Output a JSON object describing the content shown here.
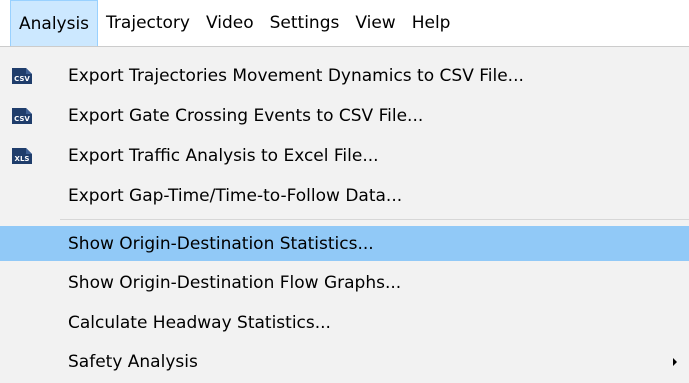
{
  "menubar": {
    "items": [
      {
        "label": "Analysis",
        "active": true
      },
      {
        "label": "Trajectory"
      },
      {
        "label": "Video"
      },
      {
        "label": "Settings"
      },
      {
        "label": "View"
      },
      {
        "label": "Help"
      }
    ]
  },
  "dropdown": {
    "items": [
      {
        "label": "Export Trajectories Movement Dynamics to CSV File...",
        "icon": "csv-file-icon",
        "icon_text": "CSV"
      },
      {
        "label": "Export Gate Crossing Events to CSV File...",
        "icon": "csv-file-icon",
        "icon_text": "CSV"
      },
      {
        "label": "Export Traffic Analysis to Excel File...",
        "icon": "xls-file-icon",
        "icon_text": "XLS"
      },
      {
        "label": "Export Gap-Time/Time-to-Follow Data..."
      },
      {
        "label": "Show Origin-Destination Statistics...",
        "highlighted": true
      },
      {
        "label": "Show Origin-Destination Flow Graphs..."
      },
      {
        "label": "Calculate Headway Statistics..."
      },
      {
        "label": "Safety Analysis",
        "submenu": true
      }
    ]
  },
  "colors": {
    "menubar_active_bg": "#cce8ff",
    "highlight_bg": "#91c9f7",
    "dropdown_bg": "#f2f2f2",
    "csv_icon_bg": "#1f3d6b",
    "xls_icon_bg": "#1f3d6b"
  }
}
